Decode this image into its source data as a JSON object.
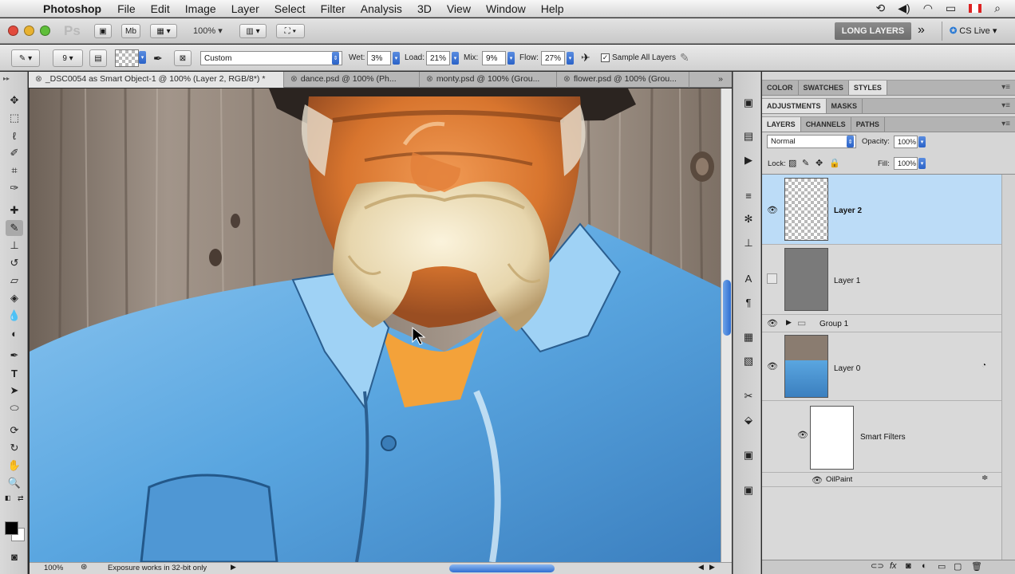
{
  "menubar": {
    "app_name": "Photoshop",
    "items": [
      "File",
      "Edit",
      "Image",
      "Layer",
      "Select",
      "Filter",
      "Analysis",
      "3D",
      "View",
      "Window",
      "Help"
    ]
  },
  "appbar": {
    "zoom": "100%",
    "workspace": "LONG LAYERS",
    "cs_live": "CS Live"
  },
  "options": {
    "brush_size": "9",
    "preset": "Custom",
    "wet_label": "Wet:",
    "wet": "3%",
    "load_label": "Load:",
    "load": "21%",
    "mix_label": "Mix:",
    "mix": "9%",
    "flow_label": "Flow:",
    "flow": "27%",
    "sample_all_layers": "Sample All Layers"
  },
  "tabs": [
    {
      "label": "_DSC0054 as Smart Object-1 @ 100% (Layer 2, RGB/8*) *"
    },
    {
      "label": "dance.psd @ 100% (Ph..."
    },
    {
      "label": "monty.psd @ 100% (Grou..."
    },
    {
      "label": "flower.psd @ 100% (Grou..."
    }
  ],
  "status": {
    "zoom": "100%",
    "message": "Exposure works in 32-bit only"
  },
  "panels": {
    "group1": [
      "COLOR",
      "SWATCHES",
      "STYLES"
    ],
    "group2": [
      "ADJUSTMENTS",
      "MASKS"
    ],
    "group3": [
      "LAYERS",
      "CHANNELS",
      "PATHS"
    ],
    "blend_mode": "Normal",
    "opacity_label": "Opacity:",
    "opacity": "100%",
    "lock_label": "Lock:",
    "fill_label": "Fill:",
    "fill": "100%",
    "layers": {
      "layer2": "Layer 2",
      "layer1": "Layer 1",
      "group1": "Group 1",
      "layer0": "Layer 0",
      "smart_filters": "Smart Filters",
      "oilpaint": "OilPaint"
    }
  },
  "colors": {
    "selected_layer": "#bcdcf7",
    "shirt_blue": "#5aa6e0",
    "accent_blue": "#2a62c8"
  }
}
